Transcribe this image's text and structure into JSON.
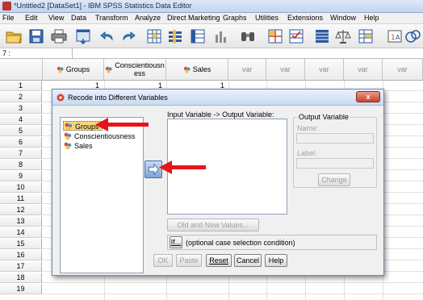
{
  "window": {
    "title": "*Untitled2 [DataSet1] - IBM SPSS Statistics Data Editor"
  },
  "menubar": {
    "items": [
      "File",
      "Edit",
      "View",
      "Data",
      "Transform",
      "Analyze",
      "Direct Marketing",
      "Graphs",
      "Utilities",
      "Extensions",
      "Window",
      "Help"
    ]
  },
  "cell_ref": "7 :",
  "grid": {
    "columns": [
      {
        "label": "Groups",
        "is_var": false
      },
      {
        "label": "Conscientiousn\ness",
        "is_var": false
      },
      {
        "label": "Sales",
        "is_var": false
      },
      {
        "label": "var",
        "is_var": true
      },
      {
        "label": "var",
        "is_var": true
      },
      {
        "label": "var",
        "is_var": true
      },
      {
        "label": "var",
        "is_var": true
      },
      {
        "label": "var",
        "is_var": true
      }
    ],
    "rows": [
      "1",
      "2",
      "3",
      "4",
      "5",
      "6",
      "7",
      "8",
      "9",
      "10",
      "11",
      "12",
      "13",
      "14",
      "15",
      "16",
      "17",
      "18",
      "19"
    ],
    "first_row_values": [
      "1",
      "1",
      "1"
    ]
  },
  "dialog": {
    "title": "Recode into Different Variables",
    "close_label": "x",
    "variables": [
      "Groups",
      "Conscientiousness",
      "Sales"
    ],
    "io_label": "Input Variable -> Output Variable:",
    "output_group_title": "Output Variable",
    "name_label": "Name:",
    "label_label": "Label:",
    "change_button": "Change",
    "old_new_button": "Old and New Values...",
    "if_button": "If...",
    "if_text": "(optional case selection condition)",
    "ok_button": "OK",
    "paste_button": "Paste",
    "reset_button": "Reset",
    "cancel_button": "Cancel",
    "help_button": "Help"
  },
  "colors": {
    "annotation_arrow": "#e8141b",
    "selected_item": "#f6d67c"
  }
}
